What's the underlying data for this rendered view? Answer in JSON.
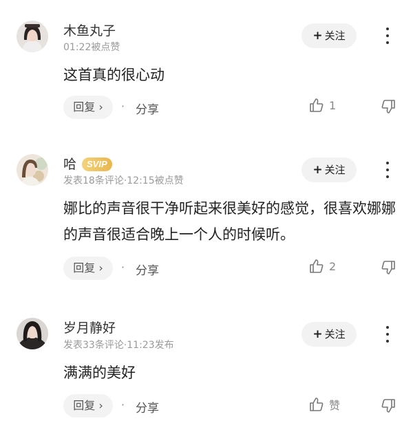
{
  "comments": [
    {
      "username": "木鱼丸子",
      "badge": "",
      "meta": "01:22被点赞",
      "content": "这首真的很心动",
      "follow_label": "关注",
      "reply_label": "回复 ›",
      "separator": "·",
      "share_label": "分享",
      "like_count": "1"
    },
    {
      "username": "哈",
      "badge": "SVIP",
      "meta": "发表18条评论·12:15被点赞",
      "content": "娜比的声音很干净听起来很美好的感觉，很喜欢娜娜的声音很适合晚上一个人的时候听。",
      "follow_label": "关注",
      "reply_label": "回复 ›",
      "separator": "·",
      "share_label": "分享",
      "like_count": "2"
    },
    {
      "username": "岁月静好",
      "badge": "",
      "meta": "发表33条评论·11:23发布",
      "content": "满满的美好",
      "follow_label": "关注",
      "reply_label": "回复 ›",
      "separator": "·",
      "share_label": "分享",
      "like_count": "赞"
    }
  ],
  "icons": {
    "follow": "plus-icon",
    "more": "more-vertical-icon",
    "like": "thumbs-up-icon",
    "dislike": "thumbs-down-icon"
  },
  "colors": {
    "svip_badge": "#e9b64f",
    "button_bg": "#f2f2f2",
    "meta_text": "#9a9a9a"
  }
}
